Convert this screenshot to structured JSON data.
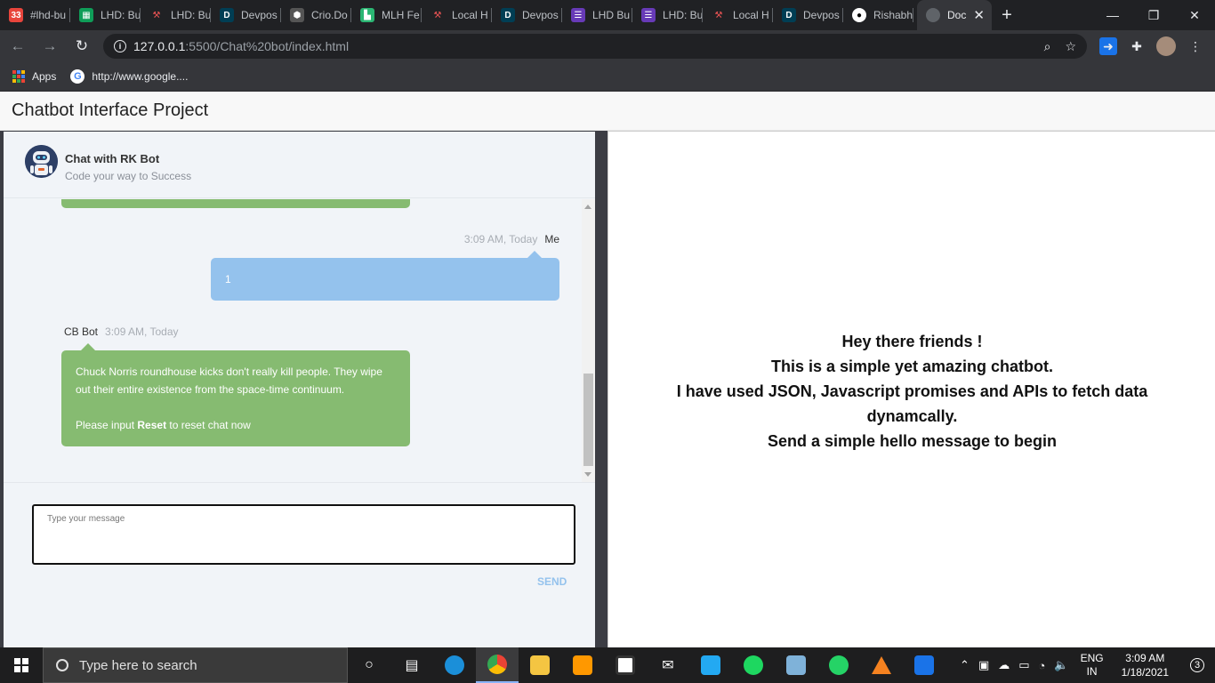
{
  "browser": {
    "tabs": [
      {
        "title": "#lhd-bu",
        "icon": "calendar-icon",
        "color": "#e8453c",
        "badge": "33"
      },
      {
        "title": "LHD: Bu",
        "icon": "sheets-icon",
        "color": "#0f9d58"
      },
      {
        "title": "LHD: Bu",
        "icon": "tools-icon",
        "color": "#c0392b"
      },
      {
        "title": "Devpos",
        "icon": "devpost-icon",
        "color": "#003e54"
      },
      {
        "title": "Crio.Do",
        "icon": "crio-icon",
        "color": "#555555"
      },
      {
        "title": "MLH Fe",
        "icon": "mlh-icon",
        "color": "#2bb673"
      },
      {
        "title": "Local H",
        "icon": "tools-icon",
        "color": "#c0392b"
      },
      {
        "title": "Devpos",
        "icon": "devpost-icon",
        "color": "#003e54"
      },
      {
        "title": "LHD Bu",
        "icon": "forms-icon",
        "color": "#673ab7"
      },
      {
        "title": "LHD: Bu",
        "icon": "forms-icon",
        "color": "#673ab7"
      },
      {
        "title": "Local H",
        "icon": "tools-icon",
        "color": "#c0392b"
      },
      {
        "title": "Devpos",
        "icon": "devpost-icon",
        "color": "#003e54"
      },
      {
        "title": "Rishabh",
        "icon": "github-icon",
        "color": "#ffffff"
      }
    ],
    "active_tab": {
      "title": "Doc",
      "icon": "globe-icon"
    },
    "url_host": "127.0.0.1",
    "url_path": ":5500/Chat%20bot/index.html",
    "bookmarks": [
      {
        "label": "Apps",
        "icon": "apps-icon"
      },
      {
        "label": "http://www.google....",
        "icon": "google-icon"
      }
    ]
  },
  "page": {
    "title": "Chatbot Interface Project"
  },
  "chat": {
    "bot_name": "Chat with RK Bot",
    "bot_tagline": "Code your way to Success",
    "messages": [
      {
        "sender": "Me",
        "time": "3:09 AM, Today",
        "text": "1"
      },
      {
        "sender": "CB Bot",
        "time": "3:09 AM, Today",
        "text": "Chuck Norris roundhouse kicks don't really kill people. They wipe out their entire existence from the space-time continuum.",
        "prompt_prefix": "Please input ",
        "prompt_keyword": "Reset",
        "prompt_suffix": " to reset chat now"
      }
    ],
    "input_placeholder": "Type your message",
    "input_value": "",
    "send_label": "SEND",
    "colors": {
      "me_bubble": "#94c2ed",
      "bot_bubble": "#86bb71",
      "send": "#94c2ed"
    }
  },
  "intro": {
    "lines": [
      "Hey there friends !",
      "This is a simple yet amazing chatbot.",
      "I have used JSON, Javascript promises and APIs to fetch data dynamcally.",
      "Send a simple hello message to begin"
    ]
  },
  "taskbar": {
    "search_placeholder": "Type here to search",
    "apps": [
      "task-view-icon",
      "timeline-icon",
      "edge-icon",
      "chrome-icon",
      "file-explorer-icon",
      "sublime-icon",
      "store-icon",
      "mail-icon",
      "vscode-icon",
      "spotify-icon",
      "notepad-icon",
      "whatsapp-icon",
      "vlc-icon",
      "share-icon"
    ],
    "lang_top": "ENG",
    "lang_bottom": "IN",
    "time": "3:09 AM",
    "date": "1/18/2021",
    "notification_count": "3"
  }
}
